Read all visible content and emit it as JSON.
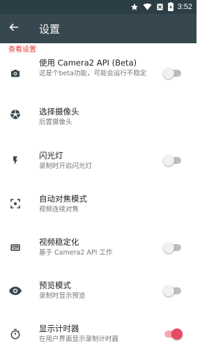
{
  "status_bar": {
    "time": "3:52",
    "icons": [
      "star-icon",
      "wifi-icon",
      "mute-icon",
      "battery-charging-icon"
    ]
  },
  "app_bar": {
    "title": "设置",
    "back_icon": "arrow-back-icon"
  },
  "section": {
    "header": "查看设置"
  },
  "settings": [
    {
      "title": "使用 Camera2 API (Beta)",
      "summary": "这是个beta功能，可能会运行不稳定",
      "icon": "camera-icon",
      "toggle": false
    },
    {
      "title": "选择摄像头",
      "summary": "后置摄像头",
      "icon": "aperture-icon"
    },
    {
      "title": "闪光灯",
      "summary": "录制时开启闪光灯",
      "icon": "flash-icon",
      "toggle": false
    },
    {
      "title": "自动对焦模式",
      "summary": "视频连续对焦",
      "icon": "center-focus-icon"
    },
    {
      "title": "视频稳定化",
      "summary": "基于 Camera2 API 工作",
      "icon": "stabilization-icon",
      "toggle": false
    },
    {
      "title": "预览模式",
      "summary": "录制时显示预览",
      "icon": "eye-icon",
      "toggle": false
    },
    {
      "title": "显示计时器",
      "summary": "在用户界面显示录制计时器",
      "icon": "timer-icon",
      "toggle": true
    }
  ],
  "colors": {
    "status_bar": "#2b3d45",
    "app_bar": "#37474f",
    "accent": "#e84a63",
    "section_header": "#e53935"
  }
}
